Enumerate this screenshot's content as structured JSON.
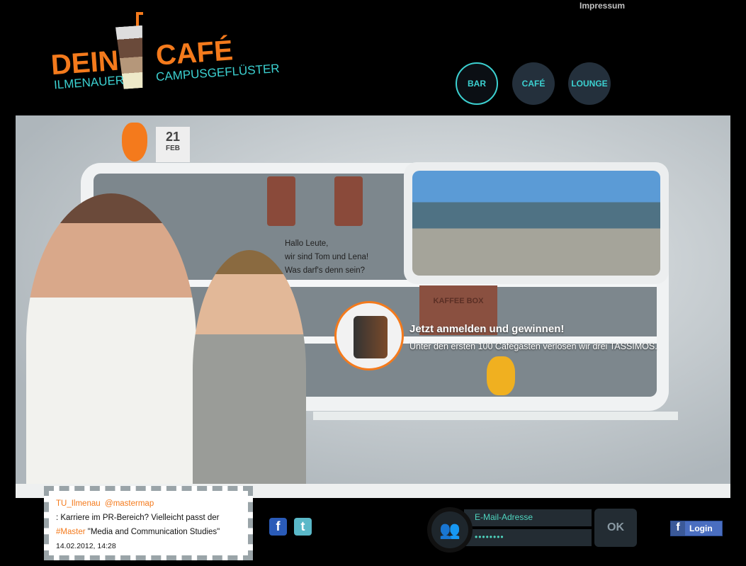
{
  "header": {
    "impressum": "Impressum",
    "logo": {
      "word1": "DEIN",
      "word2": "CAFÉ",
      "sub1": "ILMENAUER",
      "sub2": "CAMPUSGEFLÜSTER"
    },
    "nav": [
      {
        "label": "BAR",
        "active": true
      },
      {
        "label": "CAFÉ",
        "active": false
      },
      {
        "label": "LOUNGE",
        "active": false
      }
    ]
  },
  "scene": {
    "calendar": {
      "day": "21",
      "month": "FEB"
    },
    "speech": [
      "Hallo Leute,",
      "wir sind Tom und Lena!",
      "Was darf's denn sein?"
    ],
    "kaffee_box": "KAFFEE BOX"
  },
  "promo": {
    "title": "Jetzt anmelden und gewinnen!",
    "subtitle": "Unter den ersten 100 Cafégästen verlosen wir drei TASSIMOS."
  },
  "tweet": {
    "user": "TU_Ilmenau",
    "mention": "@mastermap",
    "text1": ": Karriere im PR-Bereich? Vielleicht passt der",
    "hashtag": "#Master",
    "text2": " \"Media and Communication Studies\"",
    "date": "14.02.2012, 14:28"
  },
  "social": {
    "facebook": "f",
    "twitter": "t"
  },
  "login": {
    "email_placeholder": "E-Mail-Adresse",
    "password_value": "••••••••",
    "ok": "OK",
    "fb_login": "Login",
    "fb_icon": "f"
  }
}
